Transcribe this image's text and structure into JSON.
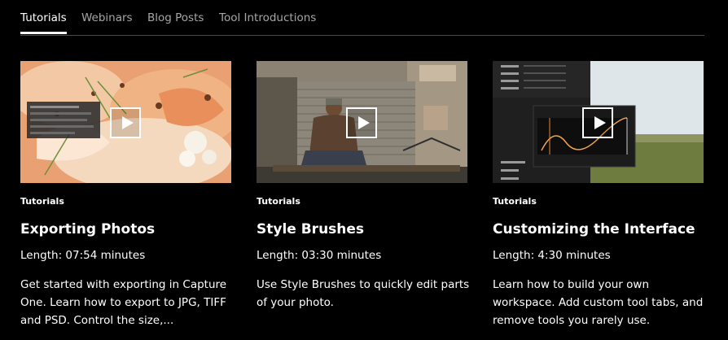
{
  "tabs": [
    {
      "label": "Tutorials",
      "active": true
    },
    {
      "label": "Webinars",
      "active": false
    },
    {
      "label": "Blog Posts",
      "active": false
    },
    {
      "label": "Tool Introductions",
      "active": false
    }
  ],
  "cards": [
    {
      "category": "Tutorials",
      "title": "Exporting Photos",
      "length": "Length: 07:54 minutes",
      "description": "Get started with exporting in Capture One. Learn how to export to JPG, TIFF and PSD. Control the size,...",
      "thumbnail_icon": "food-photo-thumbnail",
      "play_icon": "play-icon"
    },
    {
      "category": "Tutorials",
      "title": "Style Brushes",
      "length": "Length: 03:30 minutes",
      "description": "Use Style Brushes to quickly edit parts of your photo.",
      "thumbnail_icon": "street-portrait-thumbnail",
      "play_icon": "play-icon"
    },
    {
      "category": "Tutorials",
      "title": "Customizing the Interface",
      "length": "Length: 4:30 minutes",
      "description": "Learn how to build your own workspace. Add custom tool tabs, and remove tools you rarely use.",
      "thumbnail_icon": "interface-panel-thumbnail",
      "play_icon": "play-icon"
    }
  ]
}
